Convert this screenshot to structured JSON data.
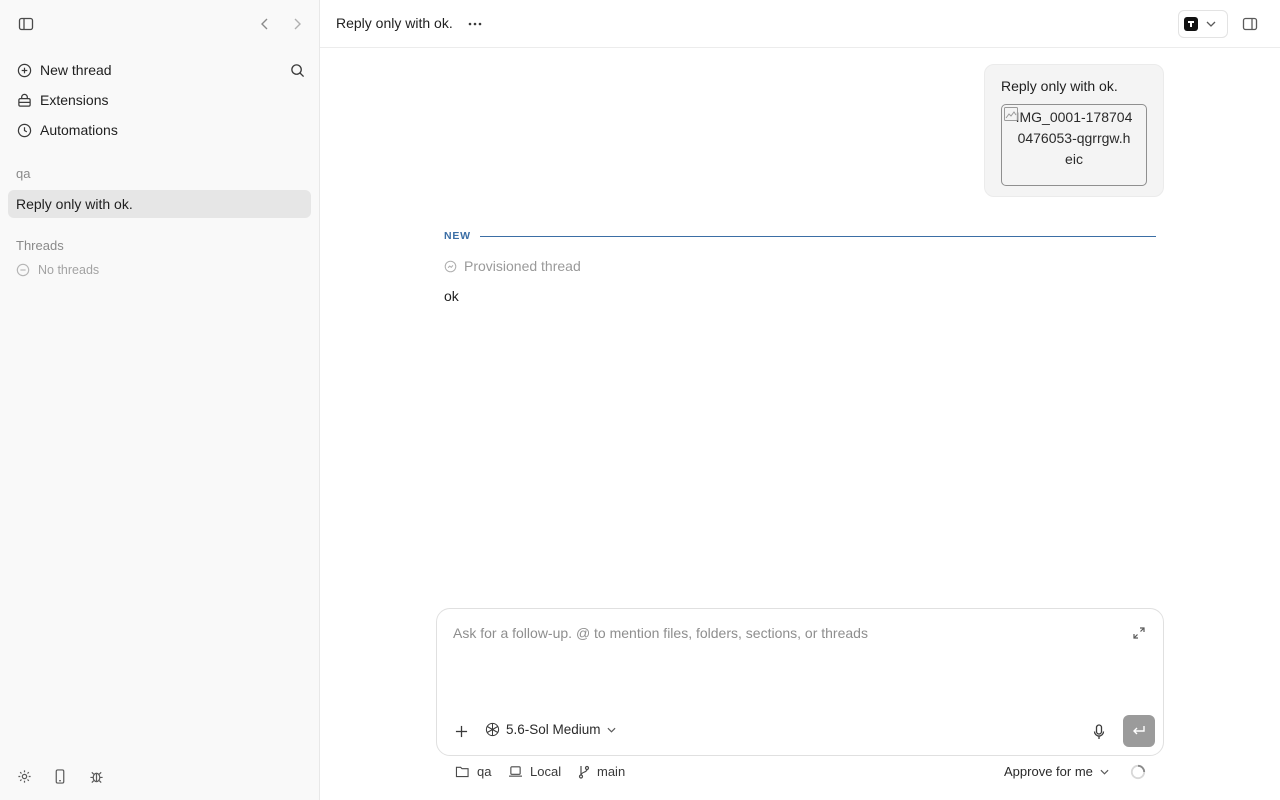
{
  "sidebar": {
    "nav": [
      {
        "label": "New thread",
        "icon": "plus-circle-icon"
      },
      {
        "label": "Extensions",
        "icon": "extensions-icon"
      },
      {
        "label": "Automations",
        "icon": "clock-icon"
      }
    ],
    "project_label": "qa",
    "active_thread": "Reply only with ok.",
    "threads_label": "Threads",
    "no_threads": "No threads"
  },
  "header": {
    "title": "Reply only with ok."
  },
  "conversation": {
    "user_message": "Reply only with ok.",
    "attachment_alt": "IMG_0001-1787040476053-qgrrgw.heic",
    "divider_label": "NEW",
    "provisioned_label": "Provisioned thread",
    "assistant_reply": "ok"
  },
  "composer": {
    "placeholder": "Ask for a follow-up. @ to mention files, folders, sections, or threads",
    "model": "5.6-Sol Medium"
  },
  "footer": {
    "project": "qa",
    "location": "Local",
    "branch": "main",
    "approval": "Approve for me"
  },
  "colors": {
    "accent": "#3b6ea5",
    "sidebar_bg": "#f9f9f9",
    "active_row": "#e6e6e6"
  }
}
